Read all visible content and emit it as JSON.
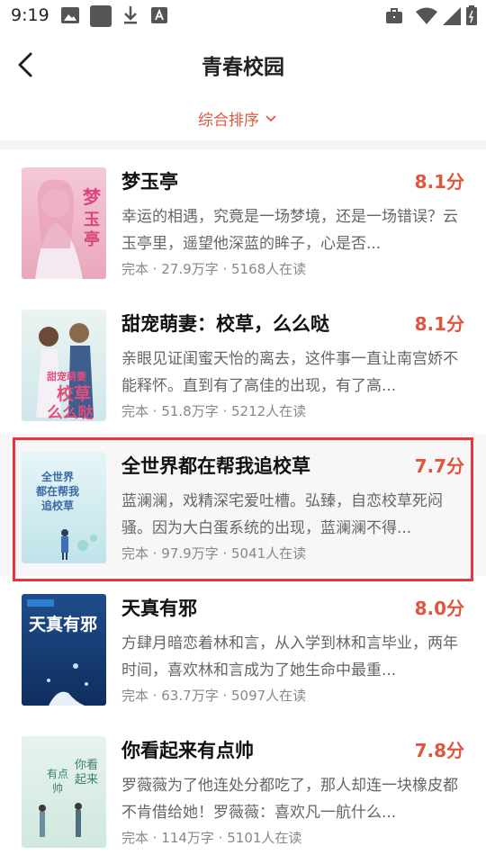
{
  "status_bar": {
    "time": "9:19"
  },
  "header": {
    "title": "青春校园",
    "sort_label": "综合排序"
  },
  "books": [
    {
      "title": "梦玉亭",
      "score": "8.1分",
      "desc": "幸运的相遇，究竟是一场梦境，还是一场错误？云玉亭里，遥望他深蓝的眸子，心是否...",
      "meta": "完本 · 27.9万字 · 5168人在读",
      "cover_text": "梦玉亭"
    },
    {
      "title": "甜宠萌妻：校草，么么哒",
      "score": "8.1分",
      "desc": "亲眼见证闺蜜天怡的离去，这件事一直让南宫娇不能释怀。直到有了高佳的出现，有了高...",
      "meta": "完本 · 51.8万字 · 5212人在读",
      "cover_text": "校草么么哒"
    },
    {
      "title": "全世界都在帮我追校草",
      "score": "7.7分",
      "desc": "蓝澜澜，戏精深宅爱吐槽。弘臻，自恋校草死闷骚。因为大白蛋系统的出现，蓝澜澜不得...",
      "meta": "完本 · 97.9万字 · 5041人在读",
      "cover_text": "全世界都在帮我追校草"
    },
    {
      "title": "天真有邪",
      "score": "8.0分",
      "desc": "方肆月暗恋着林和言，从入学到林和言毕业，两年时间，喜欢林和言成为了她生命中最重...",
      "meta": "完本 · 63.7万字 · 5097人在读",
      "cover_text": "天真有邪"
    },
    {
      "title": "你看起来有点帅",
      "score": "7.8分",
      "desc": "罗薇薇为了他连处分都吃了，那人却连一块橡皮都不肯借给她！罗薇薇：喜欢凡一航什么...",
      "meta": "完本 · 114万字 · 5101人在读",
      "cover_text": "你看起来有点帅"
    }
  ],
  "colors": {
    "accent": "#e0553e",
    "highlight": "#e8353d"
  }
}
